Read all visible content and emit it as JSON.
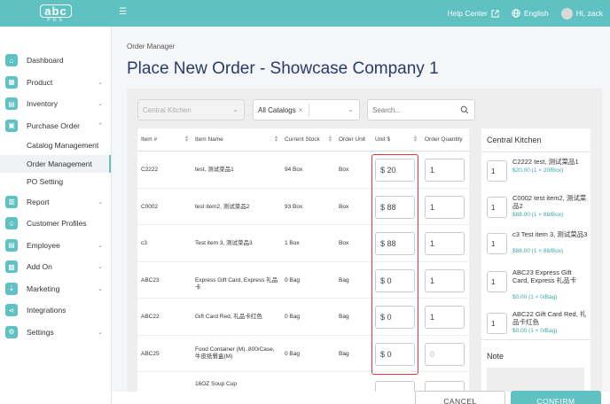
{
  "brand": {
    "logo_main": "abc",
    "logo_sub": "POS"
  },
  "topbar": {
    "help": "Help Center",
    "language": "English",
    "greeting": "Hi, zack"
  },
  "sidebar": {
    "items": [
      {
        "label": "Dashboard"
      },
      {
        "label": "Product"
      },
      {
        "label": "Inventory"
      },
      {
        "label": "Purchase Order"
      },
      {
        "label": "Report"
      },
      {
        "label": "Customer Profiles"
      },
      {
        "label": "Employee"
      },
      {
        "label": "Add On"
      },
      {
        "label": "Marketing"
      },
      {
        "label": "Integrations"
      },
      {
        "label": "Settings"
      }
    ],
    "sub_items": [
      {
        "label": "Catalog Management"
      },
      {
        "label": "Order Management"
      },
      {
        "label": "PO Setting"
      }
    ]
  },
  "page": {
    "breadcrumb": "Order Manager",
    "title": "Place New Order - Showcase Company 1"
  },
  "filters": {
    "kitchen": "Central Kitchen",
    "catalog": "All Catalogs",
    "catalog_clear": "×",
    "search_placeholder": "Search..."
  },
  "table": {
    "headers": [
      "Item #",
      "Item Name",
      "Current Stock",
      "Order Unit",
      "Unit $",
      "Order Quantity"
    ],
    "rows": [
      {
        "item_no": "C2222",
        "name": "test, 测试菜品1",
        "stock": "94 Box",
        "unit": "Box",
        "price": "$ 20",
        "qty": "1"
      },
      {
        "item_no": "C0002",
        "name": "test item2, 测试菜品2",
        "stock": "93 Box",
        "unit": "Box",
        "price": "$ 88",
        "qty": "1"
      },
      {
        "item_no": "c3",
        "name": "Test item 3, 测试菜品3",
        "stock": "1 Box",
        "unit": "Box",
        "price": "$ 88",
        "qty": "1"
      },
      {
        "item_no": "ABC23",
        "name": "Express Gift Card, Express 礼品卡",
        "stock": "0 Bag",
        "unit": "Bag",
        "price": "$ 0",
        "qty": "1"
      },
      {
        "item_no": "ABC22",
        "name": "Gift Card Red, 礼品卡红色",
        "stock": "0 Bag",
        "unit": "Bag",
        "price": "$ 0",
        "qty": "1"
      },
      {
        "item_no": "ABC25",
        "name": "Food Container (M)..800/Case, 牛皮纸餐盒(M)",
        "stock": "0 Bag",
        "unit": "Bag",
        "price": "$ 0",
        "qty_placeholder": "0"
      },
      {
        "item_no": "",
        "name": "16OZ Soup Cup",
        "stock": "",
        "unit": "",
        "price": "",
        "qty": ""
      }
    ]
  },
  "summary": {
    "title": "Central Kitchen",
    "items": [
      {
        "qty": "1",
        "name": "C2222 test, 测试菜品1",
        "price": "$20.00 (1 × 20/Box)"
      },
      {
        "qty": "1",
        "name": "C0002 test item2, 测试菜品2",
        "price": "$88.00 (1 × 88/Box)"
      },
      {
        "qty": "1",
        "name": "c3 Test item 3, 测试菜品3",
        "price": "$88.00 (1 × 88/Box)"
      },
      {
        "qty": "1",
        "name": "ABC23 Express Gift Card, Express 礼品卡",
        "price": "$0.00 (1 × 0/Bag)"
      },
      {
        "qty": "1",
        "name": "ABC22 Gift Card Red, 礼品卡红色",
        "price": "$0.00 (1 × 0/Bag)"
      }
    ],
    "note_label": "Note"
  },
  "actions": {
    "cancel": "CANCEL",
    "confirm": "CONFIRM"
  },
  "colors": {
    "accent": "#5fc1c1",
    "title": "#2a3a6b",
    "highlight": "#e03a3a"
  }
}
